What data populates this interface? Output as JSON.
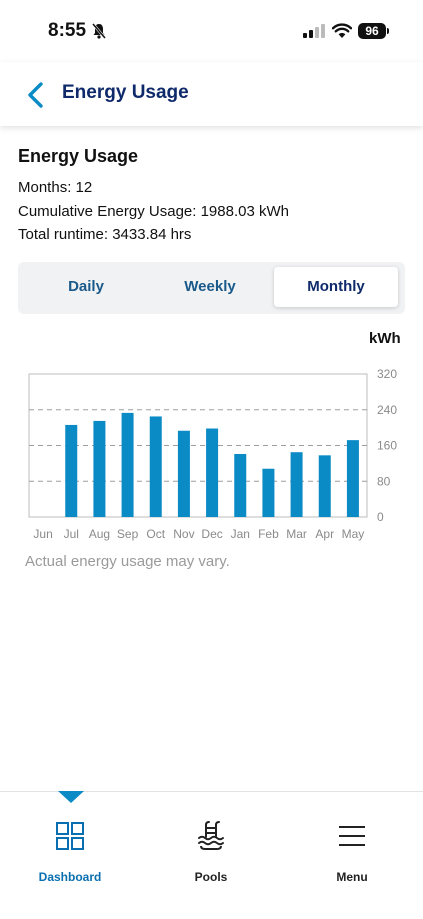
{
  "status_bar": {
    "time": "8:55",
    "battery": "96"
  },
  "header": {
    "title": "Energy Usage"
  },
  "summary": {
    "title": "Energy Usage",
    "months": "Months: 12",
    "cumulative": "Cumulative Energy Usage: 1988.03 kWh",
    "runtime": "Total runtime: 3433.84 hrs"
  },
  "tabs": {
    "daily": "Daily",
    "weekly": "Weekly",
    "monthly": "Monthly",
    "selected": "Monthly"
  },
  "chart_unit": "kWh",
  "chart_data": {
    "type": "bar",
    "categories": [
      "Jun",
      "Jul",
      "Aug",
      "Sep",
      "Oct",
      "Nov",
      "Dec",
      "Jan",
      "Feb",
      "Mar",
      "Apr",
      "May"
    ],
    "values": [
      0,
      206,
      215,
      233,
      225,
      193,
      198,
      141,
      108,
      145,
      138,
      172
    ],
    "ylabel": "kWh",
    "ylim": [
      0,
      320
    ],
    "yticks": [
      0,
      80,
      160,
      240,
      320
    ],
    "grid": true,
    "color": "#0a8bc6"
  },
  "disclaimer": "Actual energy usage may vary.",
  "nav": {
    "dashboard": "Dashboard",
    "pools": "Pools",
    "menu": "Menu"
  },
  "colors": {
    "accent": "#0a8bc6",
    "title": "#0f2a6b"
  }
}
